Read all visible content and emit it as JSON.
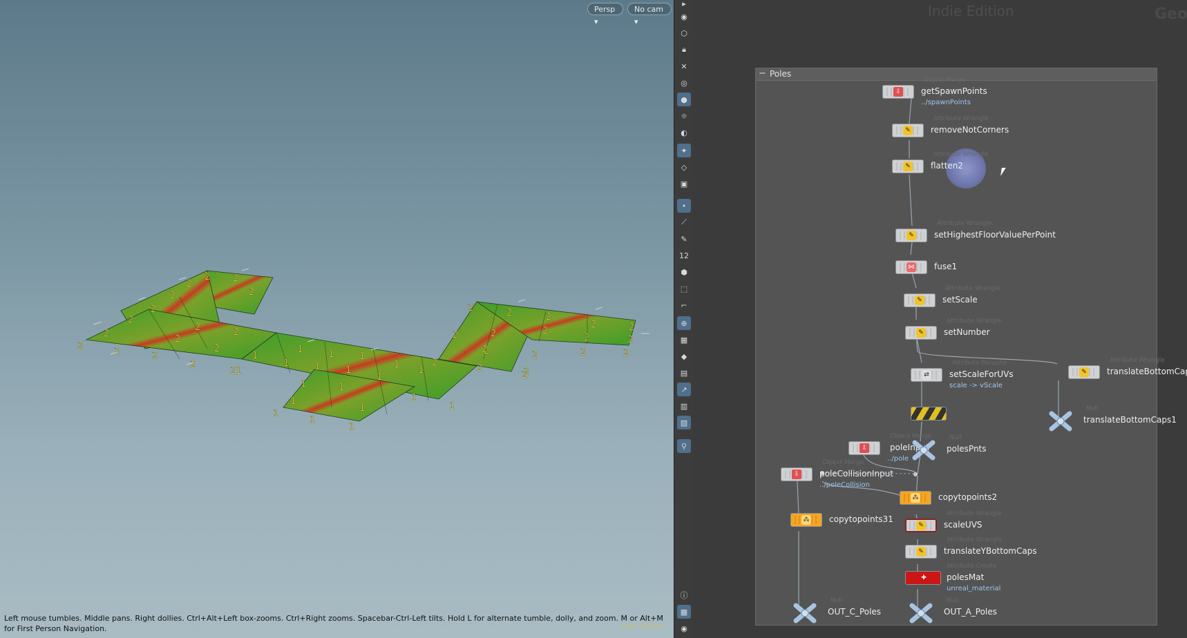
{
  "viewport": {
    "persp_label": "Persp",
    "camera_label": "No cam",
    "hint": "Left mouse tumbles. Middle pans. Right dollies. Ctrl+Alt+Left box-zooms. Ctrl+Right zooms. Spacebar-Ctrl-Left tilts. Hold L for alternate tumble, dolly, and zoom.    M or Alt+M for First Person Navigation.",
    "watermark": "Indie Edition"
  },
  "toolbar": {
    "icons": [
      "eye-icon",
      "select-icon",
      "lock-icon",
      "snap-icon",
      "display-icon",
      "light-icon",
      "bulb-icon",
      "camera-icon",
      "render-icon",
      "wire-icon",
      "scale-icon",
      "point-icon",
      "brush-icon",
      "pen-icon",
      "number-icon",
      "ghost-icon",
      "select-group-icon",
      "curve-icon",
      "pivot-icon",
      "texture-icon",
      "shading-icon",
      "uv-icon",
      "handle-icon",
      "grid-icon",
      "view-icon",
      "pin-icon",
      "info-icon",
      "pane-icon",
      "camera2-icon"
    ]
  },
  "network": {
    "edition": "Indie Edition",
    "context": "Geom",
    "box_title": "Poles",
    "nodes": [
      {
        "name": "getSpawnPoints",
        "type": "Object Merge",
        "sub": "../spawnPoints"
      },
      {
        "name": "removeNotCorners",
        "type": "Attribute Wrangle",
        "sub": ""
      },
      {
        "name": "flatten2",
        "type": "Attribute Wrangle",
        "sub": ""
      },
      {
        "name": "setHighestFloorValuePerPoint",
        "type": "Attribute Wrangle",
        "sub": ""
      },
      {
        "name": "fuse1",
        "type": "Fuse",
        "sub": ""
      },
      {
        "name": "setScale",
        "type": "Attribute Wrangle",
        "sub": ""
      },
      {
        "name": "setNumber",
        "type": "Attribute Wrangle",
        "sub": ""
      },
      {
        "name": "setScaleForUVs",
        "type": "Attribute Rename",
        "sub": "scale -> vScale"
      },
      {
        "name": "",
        "type": "",
        "sub": ""
      },
      {
        "name": "polesPnts",
        "type": "Null",
        "sub": ""
      },
      {
        "name": "poleInput",
        "type": "Object Merge",
        "sub": "../pole"
      },
      {
        "name": "poleCollisionInput",
        "type": "Object Merge",
        "sub": "../poleCollision"
      },
      {
        "name": "copytopoints2",
        "type": "Copy to Points",
        "sub": ""
      },
      {
        "name": "copytopoints31",
        "type": "Copy to Points",
        "sub": ""
      },
      {
        "name": "scaleUVS",
        "type": "Attribute Wrangle",
        "sub": ""
      },
      {
        "name": "translateYBottomCaps",
        "type": "Attribute Wrangle",
        "sub": ""
      },
      {
        "name": "polesMat",
        "type": "Attribute Create",
        "sub": "unreal_material"
      },
      {
        "name": "OUT_C_Poles",
        "type": "Null",
        "sub": ""
      },
      {
        "name": "OUT_A_Poles",
        "type": "Null",
        "sub": ""
      },
      {
        "name": "translateBottomCap",
        "type": "Attribute Wrangle",
        "sub": ""
      },
      {
        "name": "translateBottomCaps1",
        "type": "Null",
        "sub": ""
      }
    ]
  },
  "scene_labels": {
    "two": "2",
    "one": "1",
    "twenty_one": "21"
  }
}
